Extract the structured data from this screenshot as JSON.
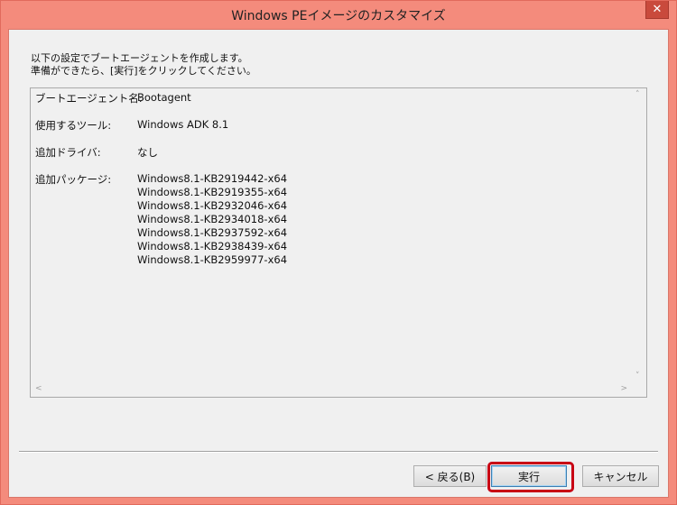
{
  "window": {
    "title": "Windows PEイメージのカスタマイズ",
    "close_symbol": "✕"
  },
  "instruction": {
    "line1": "以下の設定でブートエージェントを作成します。",
    "line2": "準備ができたら、[実行]をクリックしてください。"
  },
  "summary": {
    "agent_label": "ブートエージェント名:",
    "agent_value": "Bootagent",
    "tool_label": "使用するツール:",
    "tool_value": "Windows ADK 8.1",
    "driver_label": "追加ドライバ:",
    "driver_value": "なし",
    "package_label": "追加パッケージ:",
    "packages": [
      "Windows8.1-KB2919442-x64",
      "Windows8.1-KB2919355-x64",
      "Windows8.1-KB2932046-x64",
      "Windows8.1-KB2934018-x64",
      "Windows8.1-KB2937592-x64",
      "Windows8.1-KB2938439-x64",
      "Windows8.1-KB2959977-x64"
    ]
  },
  "scroll": {
    "up": "˄",
    "down": "˅",
    "left": "<",
    "right": ">"
  },
  "buttons": {
    "back": "< 戻る(B)",
    "execute": "実行",
    "cancel": "キャンセル"
  }
}
